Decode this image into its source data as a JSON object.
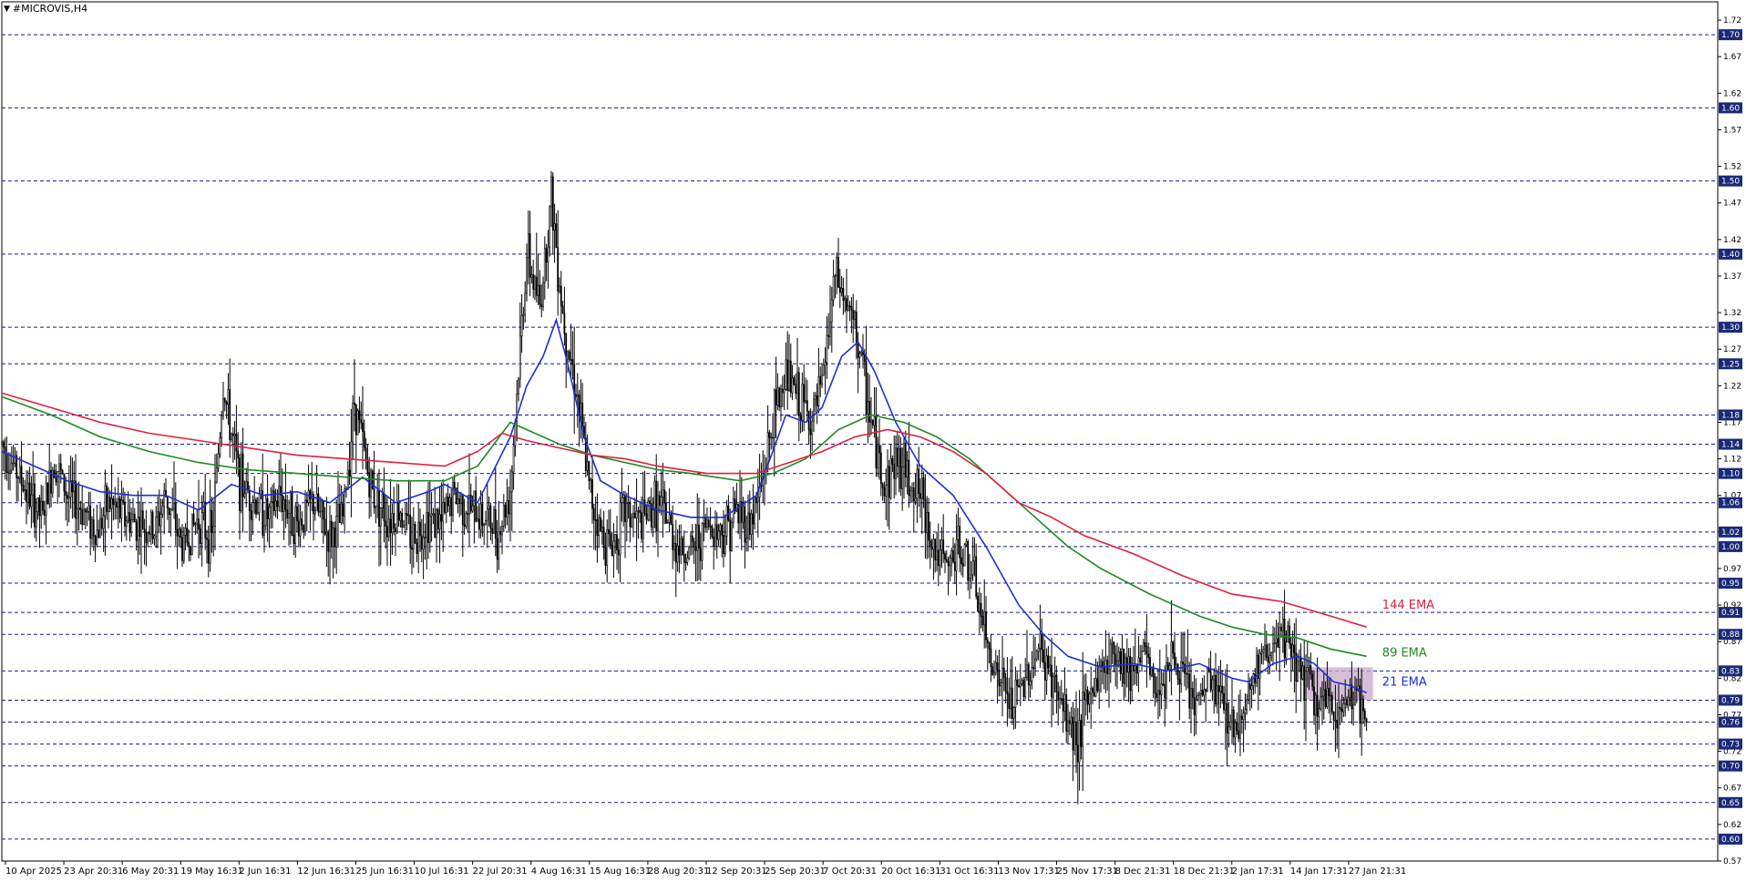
{
  "window": {
    "title": "#MICROVIS,H4",
    "menu_icon": "triangle-down-icon"
  },
  "colors": {
    "background": "#ffffff",
    "candle": "#000000",
    "grid": "#1a1a8c",
    "ema21": "#1e2fd6",
    "ema89": "#1f8a1f",
    "ema144": "#e0203c",
    "badge_bg": "#1a2a7a",
    "badge_text": "#ffffff",
    "zone": "#c7a9c9"
  },
  "chart_data": {
    "type": "candlestick",
    "symbol": "#MICROVIS",
    "timeframe": "H4",
    "ylim": [
      0.57,
      1.745
    ],
    "y_ticks": [
      "1.72",
      "1.67",
      "1.62",
      "1.57",
      "1.52",
      "1.47",
      "1.42",
      "1.37",
      "1.32",
      "1.27",
      "1.22",
      "1.17",
      "1.12",
      "1.07",
      "1.02",
      "0.97",
      "0.92",
      "0.87",
      "0.82",
      "0.77",
      "0.72",
      "0.67",
      "0.62",
      "0.57"
    ],
    "price_levels": [
      "1.70",
      "1.60",
      "1.50",
      "1.40",
      "1.30",
      "1.25",
      "1.18",
      "1.14",
      "1.10",
      "1.06",
      "1.02",
      "1.00",
      "0.95",
      "0.91",
      "0.88",
      "0.83",
      "0.79",
      "0.76",
      "0.73",
      "0.70",
      "0.65",
      "0.60"
    ],
    "x_labels": [
      "10 Apr 2025",
      "23 Apr 20:31",
      "6 May 20:31",
      "19 May 16:31",
      "2 Jun 16:31",
      "12 Jun 16:31",
      "25 Jun 16:31",
      "10 Jul 16:31",
      "22 Jul 20:31",
      "4 Aug 16:31",
      "15 Aug 16:31",
      "28 Aug 20:31",
      "12 Sep 20:31",
      "25 Sep 20:31",
      "7 Oct 20:31",
      "20 Oct 16:31",
      "31 Oct 16:31",
      "13 Nov 17:31",
      "25 Nov 17:31",
      "8 Dec 21:31",
      "18 Dec 21:31",
      "2 Jan 17:31",
      "14 Jan 17:31",
      "27 Jan 21:31"
    ],
    "close_path": [
      [
        0,
        1.14
      ],
      [
        10,
        1.1
      ],
      [
        18,
        1.06
      ],
      [
        25,
        1.04
      ],
      [
        32,
        1.12
      ],
      [
        40,
        1.07
      ],
      [
        50,
        1.05
      ],
      [
        58,
        1.02
      ],
      [
        65,
        1.06
      ],
      [
        75,
        1.04
      ],
      [
        85,
        1.03
      ],
      [
        93,
        1.02
      ],
      [
        100,
        1.07
      ],
      [
        110,
        1.0
      ],
      [
        120,
        1.04
      ],
      [
        128,
        1.01
      ],
      [
        135,
        1.22
      ],
      [
        145,
        1.09
      ],
      [
        155,
        1.06
      ],
      [
        163,
        1.04
      ],
      [
        170,
        1.07
      ],
      [
        180,
        1.03
      ],
      [
        190,
        1.06
      ],
      [
        200,
        1.01
      ],
      [
        208,
        1.04
      ],
      [
        215,
        1.2
      ],
      [
        225,
        1.08
      ],
      [
        235,
        1.04
      ],
      [
        243,
        1.05
      ],
      [
        250,
        1.01
      ],
      [
        260,
        1.04
      ],
      [
        268,
        1.03
      ],
      [
        275,
        1.07
      ],
      [
        285,
        1.05
      ],
      [
        295,
        1.04
      ],
      [
        303,
        1.02
      ],
      [
        310,
        1.08
      ],
      [
        320,
        1.4
      ],
      [
        328,
        1.33
      ],
      [
        335,
        1.48
      ],
      [
        342,
        1.32
      ],
      [
        350,
        1.22
      ],
      [
        358,
        1.08
      ],
      [
        365,
        1.02
      ],
      [
        372,
        1.0
      ],
      [
        380,
        1.05
      ],
      [
        390,
        1.03
      ],
      [
        398,
        1.06
      ],
      [
        405,
        1.04
      ],
      [
        412,
        1.0
      ],
      [
        420,
        0.99
      ],
      [
        430,
        1.03
      ],
      [
        440,
        1.02
      ],
      [
        448,
        1.05
      ],
      [
        455,
        1.03
      ],
      [
        462,
        1.07
      ],
      [
        470,
        1.17
      ],
      [
        478,
        1.24
      ],
      [
        486,
        1.2
      ],
      [
        494,
        1.17
      ],
      [
        500,
        1.22
      ],
      [
        508,
        1.37
      ],
      [
        515,
        1.33
      ],
      [
        522,
        1.28
      ],
      [
        530,
        1.17
      ],
      [
        538,
        1.08
      ],
      [
        545,
        1.12
      ],
      [
        552,
        1.1
      ],
      [
        560,
        1.07
      ],
      [
        568,
        1.0
      ],
      [
        576,
        0.97
      ],
      [
        584,
        1.0
      ],
      [
        592,
        0.96
      ],
      [
        600,
        0.87
      ],
      [
        608,
        0.82
      ],
      [
        616,
        0.78
      ],
      [
        624,
        0.82
      ],
      [
        632,
        0.86
      ],
      [
        640,
        0.82
      ],
      [
        648,
        0.77
      ],
      [
        656,
        0.74
      ],
      [
        664,
        0.8
      ],
      [
        672,
        0.84
      ],
      [
        680,
        0.86
      ],
      [
        688,
        0.83
      ],
      [
        696,
        0.86
      ],
      [
        704,
        0.8
      ],
      [
        712,
        0.85
      ],
      [
        720,
        0.82
      ],
      [
        728,
        0.78
      ],
      [
        736,
        0.82
      ],
      [
        744,
        0.79
      ],
      [
        752,
        0.75
      ],
      [
        760,
        0.8
      ],
      [
        768,
        0.85
      ],
      [
        776,
        0.86
      ],
      [
        784,
        0.87
      ],
      [
        792,
        0.83
      ],
      [
        800,
        0.79
      ],
      [
        808,
        0.78
      ],
      [
        816,
        0.77
      ],
      [
        824,
        0.81
      ],
      [
        832,
        0.75
      ]
    ],
    "ema": [
      {
        "name": "21 EMA",
        "label_price": 0.815,
        "points": [
          [
            0,
            1.13
          ],
          [
            20,
            1.11
          ],
          [
            40,
            1.09
          ],
          [
            60,
            1.075
          ],
          [
            80,
            1.07
          ],
          [
            100,
            1.07
          ],
          [
            120,
            1.05
          ],
          [
            140,
            1.085
          ],
          [
            160,
            1.07
          ],
          [
            180,
            1.075
          ],
          [
            200,
            1.06
          ],
          [
            220,
            1.095
          ],
          [
            240,
            1.06
          ],
          [
            260,
            1.075
          ],
          [
            270,
            1.085
          ],
          [
            290,
            1.06
          ],
          [
            310,
            1.15
          ],
          [
            320,
            1.22
          ],
          [
            330,
            1.26
          ],
          [
            338,
            1.31
          ],
          [
            345,
            1.25
          ],
          [
            355,
            1.15
          ],
          [
            365,
            1.09
          ],
          [
            380,
            1.07
          ],
          [
            400,
            1.05
          ],
          [
            420,
            1.04
          ],
          [
            440,
            1.04
          ],
          [
            460,
            1.07
          ],
          [
            470,
            1.13
          ],
          [
            478,
            1.18
          ],
          [
            490,
            1.17
          ],
          [
            500,
            1.19
          ],
          [
            512,
            1.26
          ],
          [
            522,
            1.28
          ],
          [
            532,
            1.24
          ],
          [
            545,
            1.17
          ],
          [
            560,
            1.11
          ],
          [
            580,
            1.07
          ],
          [
            600,
            1.0
          ],
          [
            620,
            0.92
          ],
          [
            635,
            0.88
          ],
          [
            650,
            0.85
          ],
          [
            670,
            0.835
          ],
          [
            690,
            0.84
          ],
          [
            710,
            0.83
          ],
          [
            730,
            0.84
          ],
          [
            750,
            0.82
          ],
          [
            760,
            0.815
          ],
          [
            775,
            0.84
          ],
          [
            790,
            0.85
          ],
          [
            800,
            0.84
          ],
          [
            812,
            0.815
          ],
          [
            822,
            0.81
          ],
          [
            832,
            0.8
          ]
        ]
      },
      {
        "name": "89 EMA",
        "label_price": 0.855,
        "points": [
          [
            0,
            1.205
          ],
          [
            30,
            1.18
          ],
          [
            60,
            1.15
          ],
          [
            90,
            1.13
          ],
          [
            120,
            1.115
          ],
          [
            150,
            1.105
          ],
          [
            180,
            1.1
          ],
          [
            210,
            1.095
          ],
          [
            240,
            1.09
          ],
          [
            270,
            1.09
          ],
          [
            290,
            1.11
          ],
          [
            300,
            1.14
          ],
          [
            310,
            1.17
          ],
          [
            320,
            1.16
          ],
          [
            340,
            1.14
          ],
          [
            360,
            1.125
          ],
          [
            380,
            1.115
          ],
          [
            400,
            1.105
          ],
          [
            420,
            1.1
          ],
          [
            450,
            1.09
          ],
          [
            470,
            1.1
          ],
          [
            490,
            1.12
          ],
          [
            510,
            1.16
          ],
          [
            530,
            1.18
          ],
          [
            550,
            1.17
          ],
          [
            570,
            1.15
          ],
          [
            590,
            1.12
          ],
          [
            610,
            1.08
          ],
          [
            630,
            1.04
          ],
          [
            650,
            1.0
          ],
          [
            670,
            0.97
          ],
          [
            700,
            0.935
          ],
          [
            730,
            0.905
          ],
          [
            750,
            0.89
          ],
          [
            770,
            0.88
          ],
          [
            790,
            0.875
          ],
          [
            810,
            0.86
          ],
          [
            832,
            0.85
          ]
        ]
      },
      {
        "name": "144 EMA",
        "label_price": 0.92,
        "points": [
          [
            0,
            1.21
          ],
          [
            30,
            1.19
          ],
          [
            60,
            1.17
          ],
          [
            90,
            1.155
          ],
          [
            120,
            1.145
          ],
          [
            150,
            1.135
          ],
          [
            180,
            1.125
          ],
          [
            210,
            1.12
          ],
          [
            240,
            1.115
          ],
          [
            270,
            1.11
          ],
          [
            290,
            1.13
          ],
          [
            305,
            1.155
          ],
          [
            320,
            1.145
          ],
          [
            340,
            1.135
          ],
          [
            360,
            1.125
          ],
          [
            380,
            1.12
          ],
          [
            400,
            1.11
          ],
          [
            430,
            1.1
          ],
          [
            460,
            1.1
          ],
          [
            480,
            1.115
          ],
          [
            500,
            1.13
          ],
          [
            520,
            1.15
          ],
          [
            540,
            1.16
          ],
          [
            560,
            1.15
          ],
          [
            580,
            1.13
          ],
          [
            600,
            1.1
          ],
          [
            620,
            1.06
          ],
          [
            640,
            1.04
          ],
          [
            660,
            1.015
          ],
          [
            690,
            0.99
          ],
          [
            720,
            0.96
          ],
          [
            750,
            0.935
          ],
          [
            780,
            0.925
          ],
          [
            810,
            0.905
          ],
          [
            832,
            0.89
          ]
        ]
      }
    ],
    "zone": {
      "x_from": 795,
      "x_to": 836,
      "price_top": 0.835,
      "price_bottom": 0.79
    }
  }
}
